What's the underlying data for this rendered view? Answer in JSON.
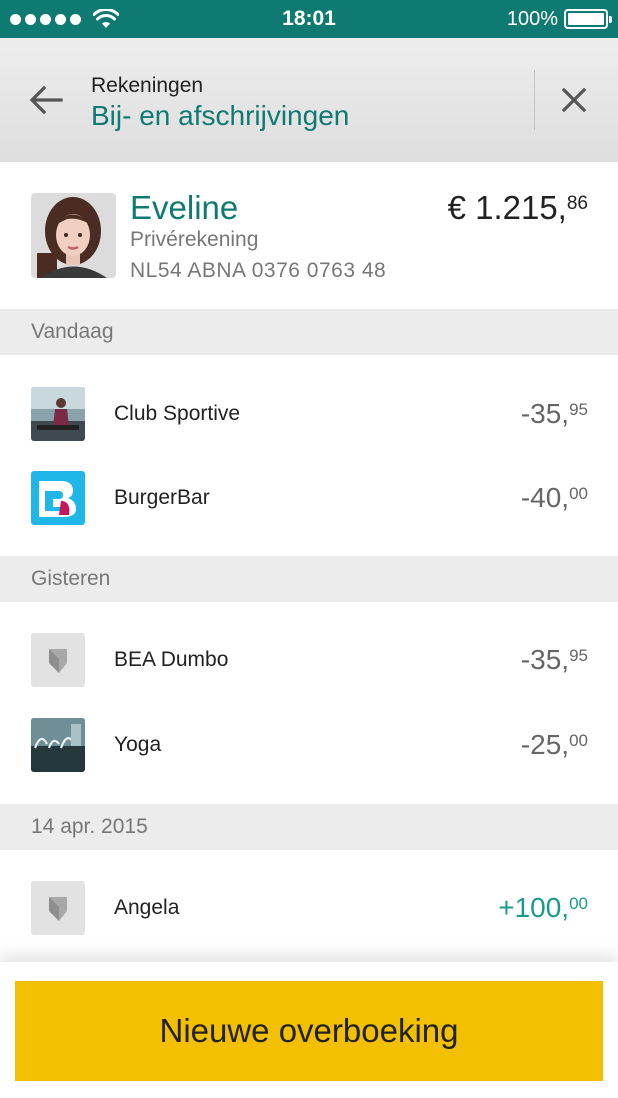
{
  "status_bar": {
    "time": "18:01",
    "battery": "100%"
  },
  "nav": {
    "parent": "Rekeningen",
    "title": "Bij- en afschrijvingen"
  },
  "account": {
    "name": "Eveline",
    "type": "Privérekening",
    "iban": "NL54 ABNA 0376 0763 48",
    "balance_main": "€ 1.215,",
    "balance_cents": "86"
  },
  "sections": [
    {
      "label": "Vandaag",
      "transactions": [
        {
          "name": "Club Sportive",
          "amount_main": "-35,",
          "amount_cents": "95",
          "icon": "fitness-photo-icon"
        },
        {
          "name": "BurgerBar",
          "amount_main": "-40,",
          "amount_cents": "00",
          "icon": "burgerbar-logo-icon"
        }
      ]
    },
    {
      "label": "Gisteren",
      "transactions": [
        {
          "name": "BEA Dumbo",
          "amount_main": "-35,",
          "amount_cents": "95",
          "icon": "bank-shield-icon"
        },
        {
          "name": "Yoga",
          "amount_main": "-25,",
          "amount_cents": "00",
          "icon": "yoga-photo-icon"
        }
      ]
    },
    {
      "label": "14 apr. 2015",
      "transactions": [
        {
          "name": "Angela",
          "amount_main": "+100,",
          "amount_cents": "00",
          "icon": "bank-shield-icon"
        }
      ]
    }
  ],
  "actions": {
    "new_transfer": "Nieuwe overboeking"
  },
  "colors": {
    "brand_teal": "#0f7a72",
    "positive": "#1a9a8c",
    "button_yellow": "#f2c000"
  }
}
